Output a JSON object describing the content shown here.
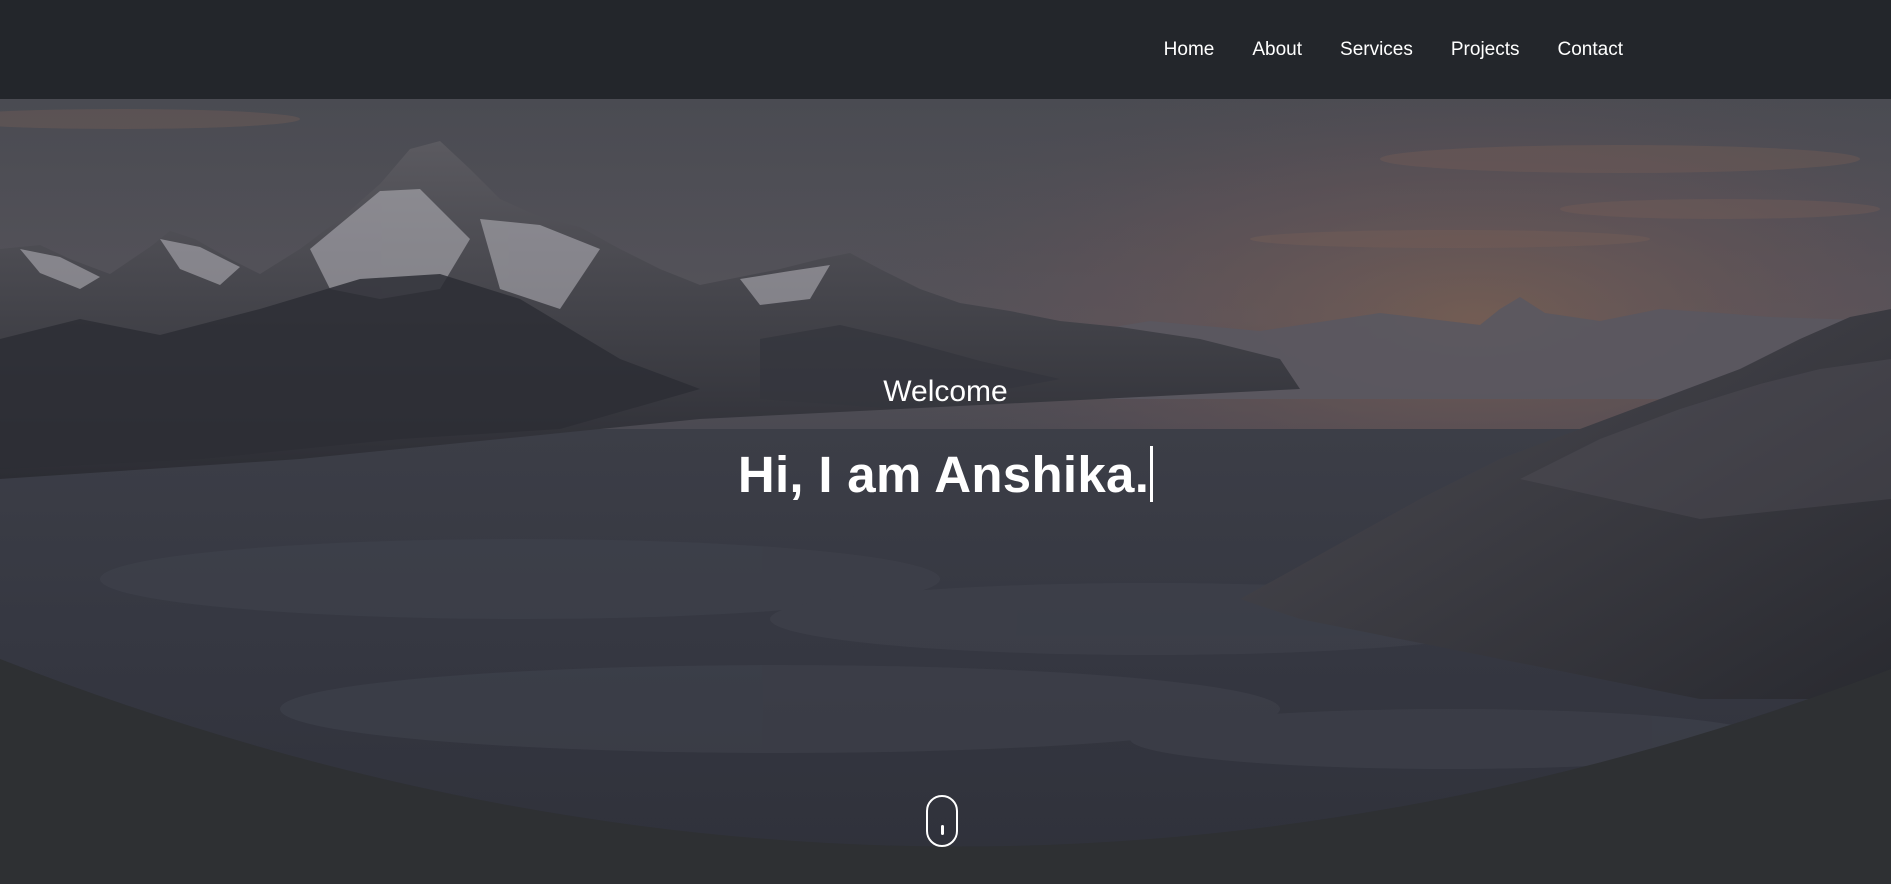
{
  "nav": {
    "items": [
      {
        "label": "Home"
      },
      {
        "label": "About"
      },
      {
        "label": "Services"
      },
      {
        "label": "Projects"
      },
      {
        "label": "Contact"
      }
    ]
  },
  "hero": {
    "welcome": "Welcome",
    "headline": "Hi, I am Anshika.",
    "background": "mountain-sunset-clouds-image",
    "scroll_indicator": "mouse-scroll-icon"
  },
  "colors": {
    "navbar_bg": "#23262b",
    "text": "#ffffff",
    "bottom_curve": "#2e3033"
  }
}
